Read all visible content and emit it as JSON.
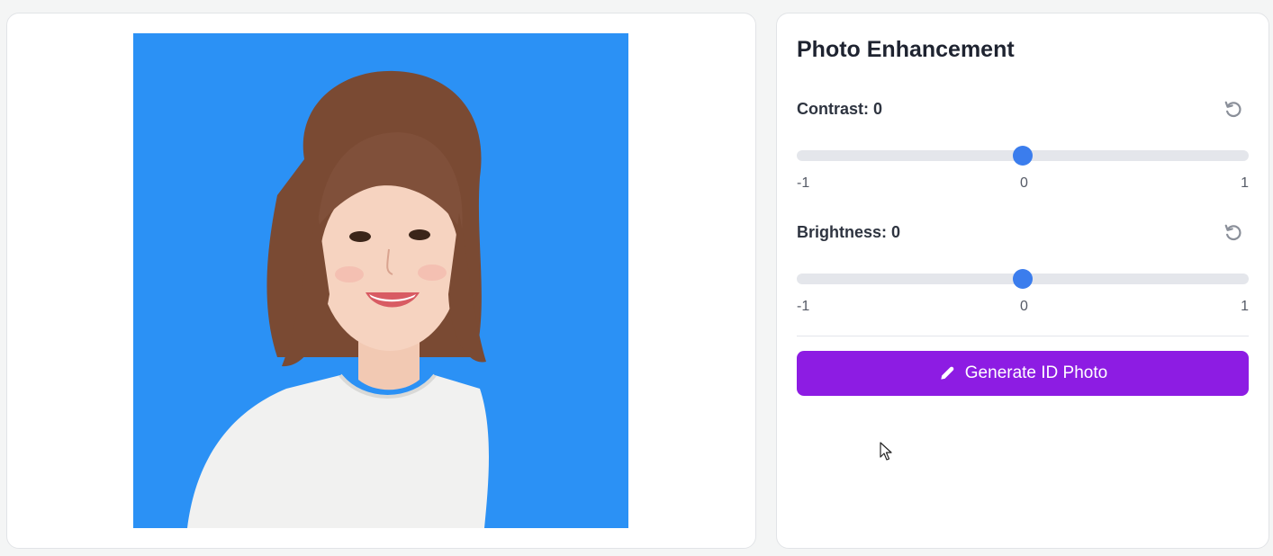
{
  "preview": {
    "background_color": "#2b91f5"
  },
  "panel": {
    "title": "Photo Enhancement",
    "contrast": {
      "label": "Contrast: 0",
      "value": 0,
      "min": -1,
      "max": 1,
      "tick_min": "-1",
      "tick_mid": "0",
      "tick_max": "1",
      "reset_icon": "reset-icon"
    },
    "brightness": {
      "label": "Brightness: 0",
      "value": 0,
      "min": -1,
      "max": 1,
      "tick_min": "-1",
      "tick_mid": "0",
      "tick_max": "1",
      "reset_icon": "reset-icon"
    },
    "generate_button": {
      "label": "Generate ID Photo",
      "icon": "pencil-icon",
      "color": "#8d1ce3"
    }
  },
  "colors": {
    "slider_thumb": "#3b7ded",
    "slider_track": "#e4e6eb"
  }
}
